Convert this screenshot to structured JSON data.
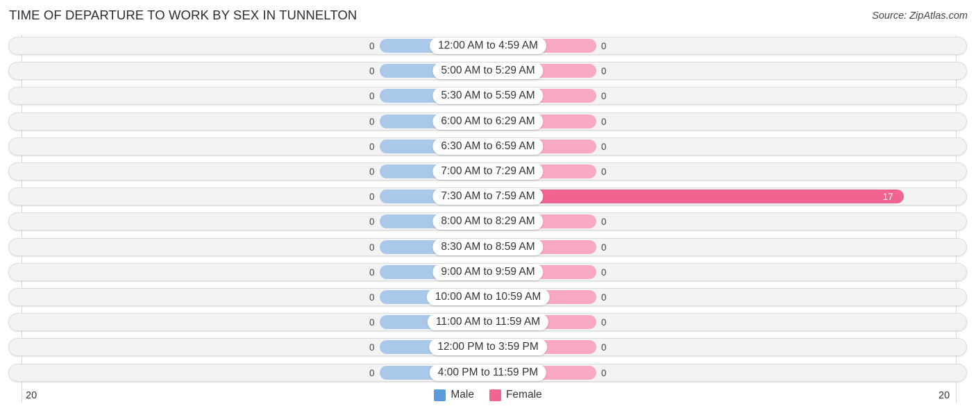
{
  "header": {
    "title": "TIME OF DEPARTURE TO WORK BY SEX IN TUNNELTON",
    "source": "Source: ZipAtlas.com"
  },
  "colors": {
    "male": "#5b9bdc",
    "male_light": "#a9c8ea",
    "female": "#f0648f",
    "female_light": "#f7a8c2"
  },
  "chart_data": {
    "type": "bar",
    "orientation": "horizontal-diverging",
    "title": "TIME OF DEPARTURE TO WORK BY SEX IN TUNNELTON",
    "categories": [
      "12:00 AM to 4:59 AM",
      "5:00 AM to 5:29 AM",
      "5:30 AM to 5:59 AM",
      "6:00 AM to 6:29 AM",
      "6:30 AM to 6:59 AM",
      "7:00 AM to 7:29 AM",
      "7:30 AM to 7:59 AM",
      "8:00 AM to 8:29 AM",
      "8:30 AM to 8:59 AM",
      "9:00 AM to 9:59 AM",
      "10:00 AM to 10:59 AM",
      "11:00 AM to 11:59 AM",
      "12:00 PM to 3:59 PM",
      "4:00 PM to 11:59 PM"
    ],
    "series": [
      {
        "name": "Male",
        "values": [
          0,
          0,
          0,
          0,
          0,
          0,
          0,
          0,
          0,
          0,
          0,
          0,
          0,
          0
        ]
      },
      {
        "name": "Female",
        "values": [
          0,
          0,
          0,
          0,
          0,
          0,
          17,
          0,
          0,
          0,
          0,
          0,
          0,
          0
        ]
      }
    ],
    "xlim": [
      -20,
      20
    ],
    "axis_tick_labels": {
      "left": "20",
      "right": "20"
    },
    "legend": {
      "position": "bottom-center",
      "entries": [
        "Male",
        "Female"
      ]
    },
    "xlabel": "",
    "ylabel": "",
    "grid": true
  }
}
